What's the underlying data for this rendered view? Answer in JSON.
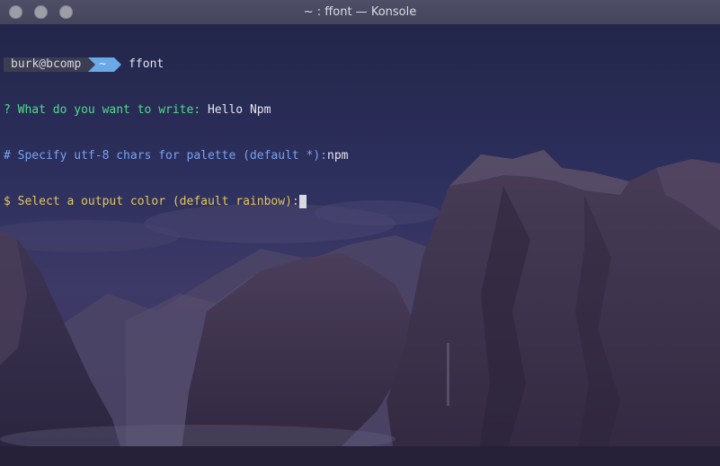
{
  "window": {
    "title": "~ : ffont — Konsole"
  },
  "prompt": {
    "user_host": "burk@bcomp",
    "directory": "~",
    "command": "ffont"
  },
  "lines": [
    {
      "symbol": "?",
      "question": "What do you want to write:",
      "answer": "Hello Npm",
      "color": "#4fdc8c"
    },
    {
      "symbol": "#",
      "question": "Specify utf-8 chars for palette (default *):",
      "answer": "npm",
      "color": "#7aa2f0"
    },
    {
      "symbol": "$",
      "question": "Select a output color (default rainbow):",
      "answer": "",
      "color": "#e2c85a"
    }
  ],
  "colors": {
    "titlebar": "#4a4a62",
    "window_button": "#9d9da8",
    "prompt_user_bg": "#3d3d52",
    "prompt_dir_bg": "#6aa8e8"
  }
}
